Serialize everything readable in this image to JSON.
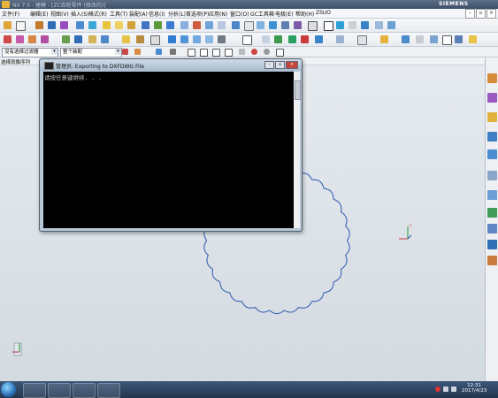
{
  "window": {
    "title": "NX 7.5 - 建模 - [ZC齿轮零件 (修改的)]",
    "brand": "SIEMENS"
  },
  "menu": [
    "文件(F)",
    "编辑(E)",
    "视图(V)",
    "插入(S)",
    "格式(R)",
    "工具(T)",
    "装配(A)",
    "信息(I)",
    "分析(L)",
    "首选项(P)",
    "应用(N)",
    "窗口(O)",
    "GC工具箱",
    "电极(E)",
    "帮助(H)",
    "ZSUO"
  ],
  "filter": {
    "type_filter": "没有选择过滤器",
    "scope": "整个装配"
  },
  "nav": {
    "label": "选择就像序列"
  },
  "console": {
    "title": "管理员: Exporting to DXFDWG File",
    "text": "请按任意键继续. . ."
  },
  "taskbar": {
    "time": "12:31",
    "date": "2017/4/23"
  },
  "colors": {
    "gear_profile": "#3c63b4",
    "console_bg": "#000000",
    "taskbar": "#22364f"
  }
}
